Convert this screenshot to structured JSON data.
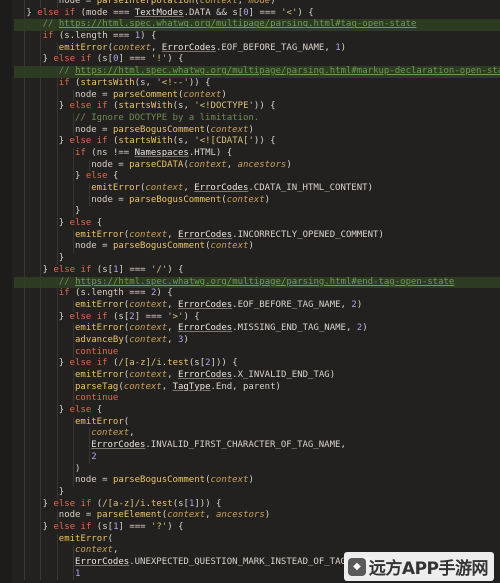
{
  "editor": {
    "lines": [
      {
        "indent": 4,
        "segments": [
          [
            "var",
            "node"
          ],
          [
            "op",
            " = "
          ],
          [
            "fn",
            "parseInterpolation"
          ],
          [
            "op",
            "("
          ],
          [
            "it",
            "context"
          ],
          [
            "op",
            ", "
          ],
          [
            "it",
            "mode"
          ],
          [
            "op",
            ")"
          ]
        ]
      },
      {
        "indent": 2,
        "fold": true,
        "segments": [
          [
            "op",
            "} "
          ],
          [
            "kw",
            "else if"
          ],
          [
            "op",
            " ("
          ],
          [
            "var",
            "mode"
          ],
          [
            "op",
            " === "
          ],
          [
            "typ",
            "TextModes"
          ],
          [
            "op",
            ".DATA "
          ],
          [
            "op",
            "&& s["
          ],
          [
            "num",
            "0"
          ],
          [
            "op",
            "] === "
          ],
          [
            "str",
            "'<'"
          ],
          [
            "op",
            ") {"
          ]
        ]
      },
      {
        "indent": 3,
        "highlight": true,
        "segments": [
          [
            "cm",
            "// "
          ],
          [
            "url",
            "https://html.spec.whatwg.org/multipage/parsing.html#tag-open-state"
          ]
        ]
      },
      {
        "indent": 3,
        "segments": [
          [
            "kw",
            "if"
          ],
          [
            "op",
            " (s."
          ],
          [
            "var",
            "length"
          ],
          [
            "op",
            " === "
          ],
          [
            "num",
            "1"
          ],
          [
            "op",
            ") {"
          ]
        ]
      },
      {
        "indent": 4,
        "segments": [
          [
            "fn",
            "emitError"
          ],
          [
            "op",
            "("
          ],
          [
            "it",
            "context"
          ],
          [
            "op",
            ", "
          ],
          [
            "typ",
            "ErrorCodes"
          ],
          [
            "op",
            ".EOF_BEFORE_TAG_NAME, "
          ],
          [
            "num",
            "1"
          ],
          [
            "op",
            ")"
          ]
        ]
      },
      {
        "indent": 3,
        "segments": [
          [
            "op",
            "} "
          ],
          [
            "kw",
            "else if"
          ],
          [
            "op",
            " (s["
          ],
          [
            "num",
            "0"
          ],
          [
            "op",
            "] === "
          ],
          [
            "str",
            "'!'"
          ],
          [
            "op",
            ") {"
          ]
        ]
      },
      {
        "indent": 4,
        "highlight": true,
        "segments": [
          [
            "cm",
            "// "
          ],
          [
            "url",
            "https://html.spec.whatwg.org/multipage/parsing.html#markup-declaration-open-state"
          ]
        ]
      },
      {
        "indent": 4,
        "segments": [
          [
            "kw",
            "if"
          ],
          [
            "op",
            " ("
          ],
          [
            "fn",
            "startsWith"
          ],
          [
            "op",
            "(s, "
          ],
          [
            "str",
            "'<!--'"
          ],
          [
            "op",
            ")) {"
          ]
        ]
      },
      {
        "indent": 5,
        "segments": [
          [
            "var",
            "node"
          ],
          [
            "op",
            " = "
          ],
          [
            "fn",
            "parseComment"
          ],
          [
            "op",
            "("
          ],
          [
            "it",
            "context"
          ],
          [
            "op",
            ")"
          ]
        ]
      },
      {
        "indent": 4,
        "segments": [
          [
            "op",
            "} "
          ],
          [
            "kw",
            "else if"
          ],
          [
            "op",
            " ("
          ],
          [
            "fn",
            "startsWith"
          ],
          [
            "op",
            "(s, "
          ],
          [
            "str",
            "'<!DOCTYPE'"
          ],
          [
            "op",
            ")) {"
          ]
        ]
      },
      {
        "indent": 5,
        "segments": [
          [
            "cm",
            "// Ignore DOCTYPE by a limitation."
          ]
        ]
      },
      {
        "indent": 5,
        "segments": [
          [
            "var",
            "node"
          ],
          [
            "op",
            " = "
          ],
          [
            "fn",
            "parseBogusComment"
          ],
          [
            "op",
            "("
          ],
          [
            "it",
            "context"
          ],
          [
            "op",
            ")"
          ]
        ]
      },
      {
        "indent": 4,
        "segments": [
          [
            "op",
            "} "
          ],
          [
            "kw",
            "else if"
          ],
          [
            "op",
            " ("
          ],
          [
            "fn",
            "startsWith"
          ],
          [
            "op",
            "(s, "
          ],
          [
            "str",
            "'<![CDATA['"
          ],
          [
            "op",
            ")) {"
          ]
        ]
      },
      {
        "indent": 5,
        "segments": [
          [
            "kw",
            "if"
          ],
          [
            "op",
            " ("
          ],
          [
            "var",
            "ns"
          ],
          [
            "op",
            " !== "
          ],
          [
            "typ",
            "Namespaces"
          ],
          [
            "op",
            ".HTML) {"
          ]
        ]
      },
      {
        "indent": 6,
        "segments": [
          [
            "var",
            "node"
          ],
          [
            "op",
            " = "
          ],
          [
            "fn",
            "parseCDATA"
          ],
          [
            "op",
            "("
          ],
          [
            "it",
            "context"
          ],
          [
            "op",
            ", "
          ],
          [
            "it",
            "ancestors"
          ],
          [
            "op",
            ")"
          ]
        ]
      },
      {
        "indent": 5,
        "segments": [
          [
            "op",
            "} "
          ],
          [
            "kw",
            "else"
          ],
          [
            "op",
            " {"
          ]
        ]
      },
      {
        "indent": 6,
        "segments": [
          [
            "fn",
            "emitError"
          ],
          [
            "op",
            "("
          ],
          [
            "it",
            "context"
          ],
          [
            "op",
            ", "
          ],
          [
            "typ",
            "ErrorCodes"
          ],
          [
            "op",
            ".CDATA_IN_HTML_CONTENT)"
          ]
        ]
      },
      {
        "indent": 6,
        "segments": [
          [
            "var",
            "node"
          ],
          [
            "op",
            " = "
          ],
          [
            "fn",
            "parseBogusComment"
          ],
          [
            "op",
            "("
          ],
          [
            "it",
            "context"
          ],
          [
            "op",
            ")"
          ]
        ]
      },
      {
        "indent": 5,
        "segments": [
          [
            "op",
            "}"
          ]
        ]
      },
      {
        "indent": 4,
        "segments": [
          [
            "op",
            "} "
          ],
          [
            "kw",
            "else"
          ],
          [
            "op",
            " {"
          ]
        ]
      },
      {
        "indent": 5,
        "segments": [
          [
            "fn",
            "emitError"
          ],
          [
            "op",
            "("
          ],
          [
            "it",
            "context"
          ],
          [
            "op",
            ", "
          ],
          [
            "typ",
            "ErrorCodes"
          ],
          [
            "op",
            ".INCORRECTLY_OPENED_COMMENT)"
          ]
        ]
      },
      {
        "indent": 5,
        "segments": [
          [
            "var",
            "node"
          ],
          [
            "op",
            " = "
          ],
          [
            "fn",
            "parseBogusComment"
          ],
          [
            "op",
            "("
          ],
          [
            "it",
            "context"
          ],
          [
            "op",
            ")"
          ]
        ]
      },
      {
        "indent": 4,
        "segments": [
          [
            "op",
            "}"
          ]
        ]
      },
      {
        "indent": 3,
        "segments": [
          [
            "op",
            "} "
          ],
          [
            "kw",
            "else if"
          ],
          [
            "op",
            " (s["
          ],
          [
            "num",
            "1"
          ],
          [
            "op",
            "] === "
          ],
          [
            "str",
            "'/'"
          ],
          [
            "op",
            ") {"
          ]
        ]
      },
      {
        "indent": 4,
        "highlight": true,
        "segments": [
          [
            "cm",
            "// "
          ],
          [
            "url",
            "https://html.spec.whatwg.org/multipage/parsing.html#end-tag-open-state"
          ]
        ]
      },
      {
        "indent": 4,
        "segments": [
          [
            "kw",
            "if"
          ],
          [
            "op",
            " (s."
          ],
          [
            "var",
            "length"
          ],
          [
            "op",
            " === "
          ],
          [
            "num",
            "2"
          ],
          [
            "op",
            ") {"
          ]
        ]
      },
      {
        "indent": 5,
        "segments": [
          [
            "fn",
            "emitError"
          ],
          [
            "op",
            "("
          ],
          [
            "it",
            "context"
          ],
          [
            "op",
            ", "
          ],
          [
            "typ",
            "ErrorCodes"
          ],
          [
            "op",
            ".EOF_BEFORE_TAG_NAME, "
          ],
          [
            "num",
            "2"
          ],
          [
            "op",
            ")"
          ]
        ]
      },
      {
        "indent": 4,
        "segments": [
          [
            "op",
            "} "
          ],
          [
            "kw",
            "else if"
          ],
          [
            "op",
            " (s["
          ],
          [
            "num",
            "2"
          ],
          [
            "op",
            "] === "
          ],
          [
            "str",
            "'>'"
          ],
          [
            "op",
            ") {"
          ]
        ]
      },
      {
        "indent": 5,
        "segments": [
          [
            "fn",
            "emitError"
          ],
          [
            "op",
            "("
          ],
          [
            "it",
            "context"
          ],
          [
            "op",
            ", "
          ],
          [
            "typ",
            "ErrorCodes"
          ],
          [
            "op",
            ".MISSING_END_TAG_NAME, "
          ],
          [
            "num",
            "2"
          ],
          [
            "op",
            ")"
          ]
        ]
      },
      {
        "indent": 5,
        "segments": [
          [
            "fn",
            "advanceBy"
          ],
          [
            "op",
            "("
          ],
          [
            "it",
            "context"
          ],
          [
            "op",
            ", "
          ],
          [
            "num",
            "3"
          ],
          [
            "op",
            ")"
          ]
        ]
      },
      {
        "indent": 5,
        "segments": [
          [
            "kw",
            "continue"
          ]
        ]
      },
      {
        "indent": 4,
        "segments": [
          [
            "op",
            "} "
          ],
          [
            "kw",
            "else if"
          ],
          [
            "op",
            " ("
          ],
          [
            "str",
            "/[a-z]/i"
          ],
          [
            "op",
            "."
          ],
          [
            "fn",
            "test"
          ],
          [
            "op",
            "(s["
          ],
          [
            "num",
            "2"
          ],
          [
            "op",
            "])) {"
          ]
        ]
      },
      {
        "indent": 5,
        "segments": [
          [
            "fn",
            "emitError"
          ],
          [
            "op",
            "("
          ],
          [
            "it",
            "context"
          ],
          [
            "op",
            ", "
          ],
          [
            "typ",
            "ErrorCodes"
          ],
          [
            "op",
            ".X_INVALID_END_TAG)"
          ]
        ]
      },
      {
        "indent": 5,
        "segments": [
          [
            "fn",
            "parseTag"
          ],
          [
            "op",
            "("
          ],
          [
            "it",
            "context"
          ],
          [
            "op",
            ", "
          ],
          [
            "typ",
            "TagType"
          ],
          [
            "op",
            ".End, parent)"
          ]
        ]
      },
      {
        "indent": 5,
        "segments": [
          [
            "kw",
            "continue"
          ]
        ]
      },
      {
        "indent": 4,
        "segments": [
          [
            "op",
            "} "
          ],
          [
            "kw",
            "else"
          ],
          [
            "op",
            " {"
          ]
        ]
      },
      {
        "indent": 5,
        "segments": [
          [
            "fn",
            "emitError"
          ],
          [
            "op",
            "("
          ]
        ]
      },
      {
        "indent": 6,
        "segments": [
          [
            "it",
            "context"
          ],
          [
            "op",
            ","
          ]
        ]
      },
      {
        "indent": 6,
        "segments": [
          [
            "typ",
            "ErrorCodes"
          ],
          [
            "op",
            ".INVALID_FIRST_CHARACTER_OF_TAG_NAME,"
          ]
        ]
      },
      {
        "indent": 6,
        "segments": [
          [
            "num",
            "2"
          ]
        ]
      },
      {
        "indent": 5,
        "segments": [
          [
            "op",
            ")"
          ]
        ]
      },
      {
        "indent": 5,
        "segments": [
          [
            "var",
            "node"
          ],
          [
            "op",
            " = "
          ],
          [
            "fn",
            "parseBogusComment"
          ],
          [
            "op",
            "("
          ],
          [
            "it",
            "context"
          ],
          [
            "op",
            ")"
          ]
        ]
      },
      {
        "indent": 4,
        "segments": [
          [
            "op",
            "}"
          ]
        ]
      },
      {
        "indent": 3,
        "segments": [
          [
            "op",
            "} "
          ],
          [
            "kw",
            "else if"
          ],
          [
            "op",
            " ("
          ],
          [
            "str",
            "/[a-z]/i"
          ],
          [
            "op",
            "."
          ],
          [
            "fn",
            "test"
          ],
          [
            "op",
            "(s["
          ],
          [
            "num",
            "1"
          ],
          [
            "op",
            "])) {"
          ]
        ]
      },
      {
        "indent": 4,
        "segments": [
          [
            "var",
            "node"
          ],
          [
            "op",
            " = "
          ],
          [
            "fn",
            "parseElement"
          ],
          [
            "op",
            "("
          ],
          [
            "it",
            "context"
          ],
          [
            "op",
            ", "
          ],
          [
            "it",
            "ancestors"
          ],
          [
            "op",
            ")"
          ]
        ]
      },
      {
        "indent": 3,
        "segments": [
          [
            "op",
            "} "
          ],
          [
            "kw",
            "else if"
          ],
          [
            "op",
            " (s["
          ],
          [
            "num",
            "1"
          ],
          [
            "op",
            "] === "
          ],
          [
            "str",
            "'?'"
          ],
          [
            "op",
            ") {"
          ]
        ]
      },
      {
        "indent": 4,
        "segments": [
          [
            "fn",
            "emitError"
          ],
          [
            "op",
            "("
          ]
        ]
      },
      {
        "indent": 5,
        "segments": [
          [
            "it",
            "context"
          ],
          [
            "op",
            ","
          ]
        ]
      },
      {
        "indent": 5,
        "segments": [
          [
            "typ",
            "ErrorCodes"
          ],
          [
            "op",
            ".UNEXPECTED_QUESTION_MARK_INSTEAD_OF_TAG_NAME,"
          ]
        ]
      },
      {
        "indent": 5,
        "segments": [
          [
            "num",
            "1"
          ]
        ]
      }
    ]
  },
  "watermark": {
    "text": "远方APP手游网",
    "logo_glyph": "◆"
  },
  "colors": {
    "background": "#23211f",
    "keyword": "#e1694f",
    "function": "#e9c46a",
    "comment": "#6e8d57",
    "highlight_line": "#2d3b22"
  }
}
